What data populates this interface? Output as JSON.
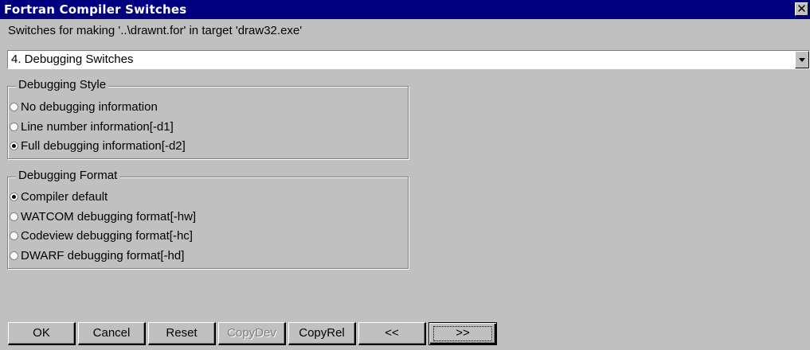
{
  "window": {
    "title": "Fortran Compiler Switches",
    "close_glyph": "✕"
  },
  "subtitle": "Switches for making '..\\drawnt.for' in target 'draw32.exe'",
  "category": {
    "selected": "4. Debugging Switches"
  },
  "debug_style": {
    "label": "Debugging Style",
    "options": [
      {
        "label": "No debugging information",
        "checked": false
      },
      {
        "label": "Line number information[-d1]",
        "checked": false
      },
      {
        "label": "Full debugging information[-d2]",
        "checked": true
      }
    ]
  },
  "debug_format": {
    "label": "Debugging Format",
    "options": [
      {
        "label": "Compiler default",
        "checked": true
      },
      {
        "label": "WATCOM debugging format[-hw]",
        "checked": false
      },
      {
        "label": "Codeview debugging format[-hc]",
        "checked": false
      },
      {
        "label": "DWARF debugging format[-hd]",
        "checked": false
      }
    ]
  },
  "buttons": {
    "ok": "OK",
    "cancel": "Cancel",
    "reset": "Reset",
    "copydev": "CopyDev",
    "copyrel": "CopyRel",
    "prev": "<<",
    "next": ">>"
  },
  "colors": {
    "titlebar": "#000080",
    "face": "#c0c0c0"
  }
}
